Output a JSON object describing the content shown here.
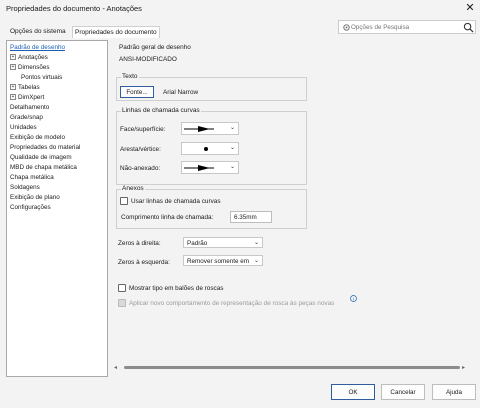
{
  "window": {
    "title": "Propriedades do documento - Anotações"
  },
  "tabs": [
    {
      "label": "Opções do sistema"
    },
    {
      "label": "Propriedades do documento"
    }
  ],
  "search": {
    "placeholder": "Opções de Pesquisa"
  },
  "tree": {
    "items": [
      {
        "label": "Padrão de desenho",
        "selected": true,
        "expandable": false,
        "indent": 0
      },
      {
        "label": "Anotações",
        "selected": false,
        "expandable": true,
        "indent": 0
      },
      {
        "label": "Dimensões",
        "selected": false,
        "expandable": true,
        "indent": 0
      },
      {
        "label": "Pontos virtuais",
        "selected": false,
        "expandable": false,
        "indent": 1
      },
      {
        "label": "Tabelas",
        "selected": false,
        "expandable": true,
        "indent": 0
      },
      {
        "label": "DimXpert",
        "selected": false,
        "expandable": true,
        "indent": 0
      },
      {
        "label": "Detalhamento",
        "selected": false,
        "expandable": false,
        "indent": 0
      },
      {
        "label": "Grade/snap",
        "selected": false,
        "expandable": false,
        "indent": 0
      },
      {
        "label": "Unidades",
        "selected": false,
        "expandable": false,
        "indent": 0
      },
      {
        "label": "Exibição de modelo",
        "selected": false,
        "expandable": false,
        "indent": 0
      },
      {
        "label": "Propriedades do material",
        "selected": false,
        "expandable": false,
        "indent": 0
      },
      {
        "label": "Qualidade de imagem",
        "selected": false,
        "expandable": false,
        "indent": 0
      },
      {
        "label": "MBD de chapa metálica",
        "selected": false,
        "expandable": false,
        "indent": 0
      },
      {
        "label": "Chapa metálica",
        "selected": false,
        "expandable": false,
        "indent": 0
      },
      {
        "label": "Soldagens",
        "selected": false,
        "expandable": false,
        "indent": 0
      },
      {
        "label": "Exibição de plano",
        "selected": false,
        "expandable": false,
        "indent": 0
      },
      {
        "label": "Configurações",
        "selected": false,
        "expandable": false,
        "indent": 0
      }
    ]
  },
  "main": {
    "standard_label": "Padrão geral de desenho",
    "standard_value": "ANSI-MODIFICADO",
    "text_group": {
      "title": "Texto",
      "font_button": "Fonte...",
      "font_name": "Arial Narrow"
    },
    "leader_group": {
      "title": "Linhas de chamada curvas",
      "rows": [
        {
          "label": "Face/superfície:"
        },
        {
          "label": "Aresta/vértice:"
        },
        {
          "label": "Não-anexado:"
        }
      ]
    },
    "attached_group": {
      "title": "Anexos",
      "checkbox_label": "Usar linhas de chamada curvas",
      "length_label": "Comprimento linha de chamada:",
      "length_value": "6.35mm"
    },
    "leading_zeros": {
      "label": "Zeros à direita:",
      "value": "Padrão"
    },
    "trailing_zeros": {
      "label": "Zeros à esquerda:",
      "value": "Remover somente em"
    },
    "show_type_checkbox": "Mostrar tipo em balões de roscas",
    "new_thread_checkbox": "Aplicar novo comportamento de representação de rosca às peças novas"
  },
  "footer": {
    "ok": "OK",
    "cancel": "Cancelar",
    "help": "Ajuda"
  },
  "colors": {
    "accent": "#1a5fb4",
    "primary_border": "#2f5d9e",
    "background": "#f3f3f3"
  }
}
